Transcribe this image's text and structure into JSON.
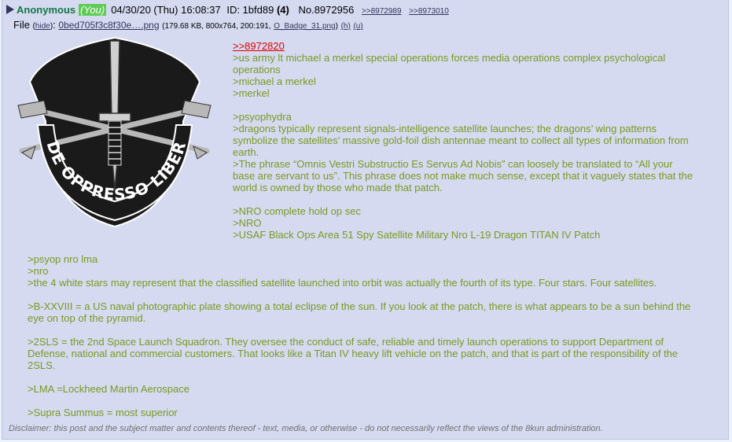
{
  "post": {
    "name": "Anonymous",
    "you_tag": "(You)",
    "date": "04/30/20 (Thu) 16:08:37",
    "id_label": "ID: 1bfd89",
    "id_count": "(4)",
    "post_no": "No.8972956",
    "backlinks": [
      ">>8972989",
      ">>8973010"
    ]
  },
  "file": {
    "label": "File",
    "hide_label": "hide",
    "filename": "0bed705f3c8f30e….png",
    "meta": "(179.68 KB, 800x764, 200:191,",
    "original_name": "O_Badge_31.png",
    "h_label": "(h)",
    "u_label": "(u)"
  },
  "badge": {
    "motto": "DE OPPRESSO LIBER",
    "colors": {
      "black": "#1a1a1a",
      "silver": "#c8c8c8",
      "white": "#ffffff"
    }
  },
  "body_top": [
    {
      "type": "quotelink",
      "text": ">>8972820"
    },
    {
      "type": "green",
      "text": ">us army lt michael a merkel special operations forces media operations complex psychological operations"
    },
    {
      "type": "green",
      "text": ">michael a merkel"
    },
    {
      "type": "green",
      "text": ">merkel"
    },
    {
      "type": "blank",
      "text": ""
    },
    {
      "type": "green",
      "text": ">psyophydra"
    },
    {
      "type": "green",
      "text": ">dragons typically represent signals-intelligence satellite launches; the dragons’ wing patterns symbolize the satellites’ massive gold-foil dish antennae meant to collect all types of information from earth."
    },
    {
      "type": "green",
      "text": ">The phrase “Omnis Vestri Substructio Es Servus Ad Nobis” can loosely be translated to “All your base are servant to us”. This phrase does not make much sense, except that it vaguely states that the world is owned by those who made that patch."
    },
    {
      "type": "blank",
      "text": ""
    },
    {
      "type": "green",
      "text": ">NRO complete hold op sec"
    },
    {
      "type": "green",
      "text": ">NRO"
    },
    {
      "type": "green",
      "text": ">USAF Black Ops Area 51 Spy Satellite Military Nro L-19 Dragon TITAN IV Patch"
    }
  ],
  "body_bottom": [
    {
      "type": "green",
      "text": ">psyop nro lma"
    },
    {
      "type": "green",
      "text": ">nro"
    },
    {
      "type": "green",
      "text": ">the 4 white stars may represent that the classified satellite launched into orbit was actually the fourth of its type. Four stars. Four satellites."
    },
    {
      "type": "blank",
      "text": ""
    },
    {
      "type": "green",
      "text": ">B-XXVIII = a US naval photographic plate showing a total eclipse of the sun. If you look at the patch, there is what appears to be a sun behind the eye on top of the pyramid."
    },
    {
      "type": "blank",
      "text": ""
    },
    {
      "type": "green",
      "text": ">2SLS = the 2nd Space Launch Squadron. They oversee the conduct of safe, reliable and timely launch operations to support Department of Defense, national and commercial customers. That looks like a Titan IV heavy lift vehicle on the patch, and that is part of the responsibility of the 2SLS."
    },
    {
      "type": "blank",
      "text": ""
    },
    {
      "type": "green",
      "text": ">LMA =Lockheed Martin Aerospace"
    },
    {
      "type": "blank",
      "text": ""
    },
    {
      "type": "green",
      "text": ">Supra Summus = most superior"
    }
  ],
  "disclaimer": "Disclaimer: this post and the subject matter and contents thereof - text, media, or otherwise - do not necessarily reflect the views of the 8kun administration."
}
